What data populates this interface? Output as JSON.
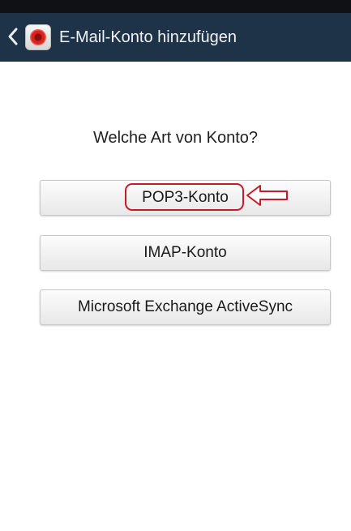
{
  "action_bar": {
    "title": "E-Mail-Konto hinzufügen",
    "back_icon": "chevron-left-icon",
    "app_icon": "email-app-icon",
    "background_color": "#1e3347"
  },
  "main": {
    "question": "Welche Art von Konto?",
    "options": [
      {
        "label": "POP3-Konto",
        "highlighted": true
      },
      {
        "label": "IMAP-Konto",
        "highlighted": false
      },
      {
        "label": "Microsoft Exchange ActiveSync",
        "highlighted": false
      }
    ]
  },
  "annotation": {
    "color": "#c71a2a",
    "icon": "arrow-left-outline-icon"
  }
}
